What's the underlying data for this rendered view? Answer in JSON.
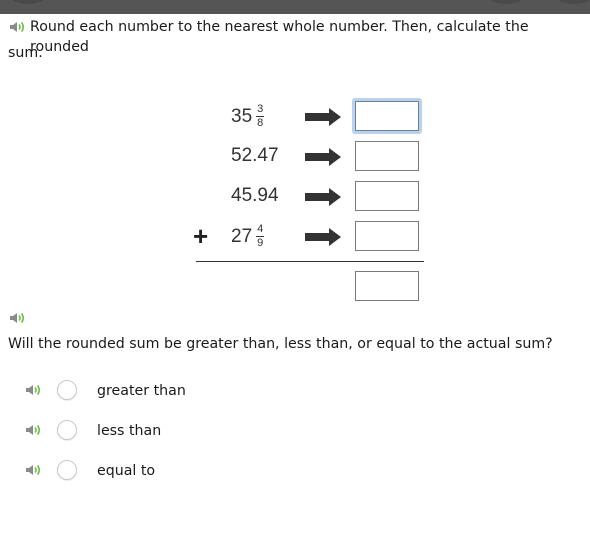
{
  "colors": {
    "topbar": "#555555",
    "speaker_gray": "#8a8a8a",
    "speaker_green": "#6cc04a",
    "focus_glow": "#b9d3ec",
    "arrow": "#333333"
  },
  "instruction": {
    "icon": "speaker-icon",
    "line1": "Round each number to the nearest whole number. Then, calculate the rounded",
    "line2": "sum."
  },
  "problem": {
    "operator": "+",
    "rows": [
      {
        "whole": "35",
        "numerator": "3",
        "denominator": "8",
        "type": "mixed",
        "answer": "",
        "focused": true
      },
      {
        "value": "52.47",
        "type": "decimal",
        "answer": ""
      },
      {
        "value": "45.94",
        "type": "decimal",
        "answer": ""
      },
      {
        "whole": "27",
        "numerator": "4",
        "denominator": "9",
        "type": "mixed",
        "answer": ""
      }
    ],
    "arrow_icon": "right-arrow-icon",
    "sum_answer": ""
  },
  "question": {
    "icon": "speaker-icon",
    "text": "Will the rounded sum be greater than, less than, or equal to the actual sum?"
  },
  "options": [
    {
      "label": "greater than",
      "selected": false
    },
    {
      "label": "less than",
      "selected": false
    },
    {
      "label": "equal to",
      "selected": false
    }
  ]
}
